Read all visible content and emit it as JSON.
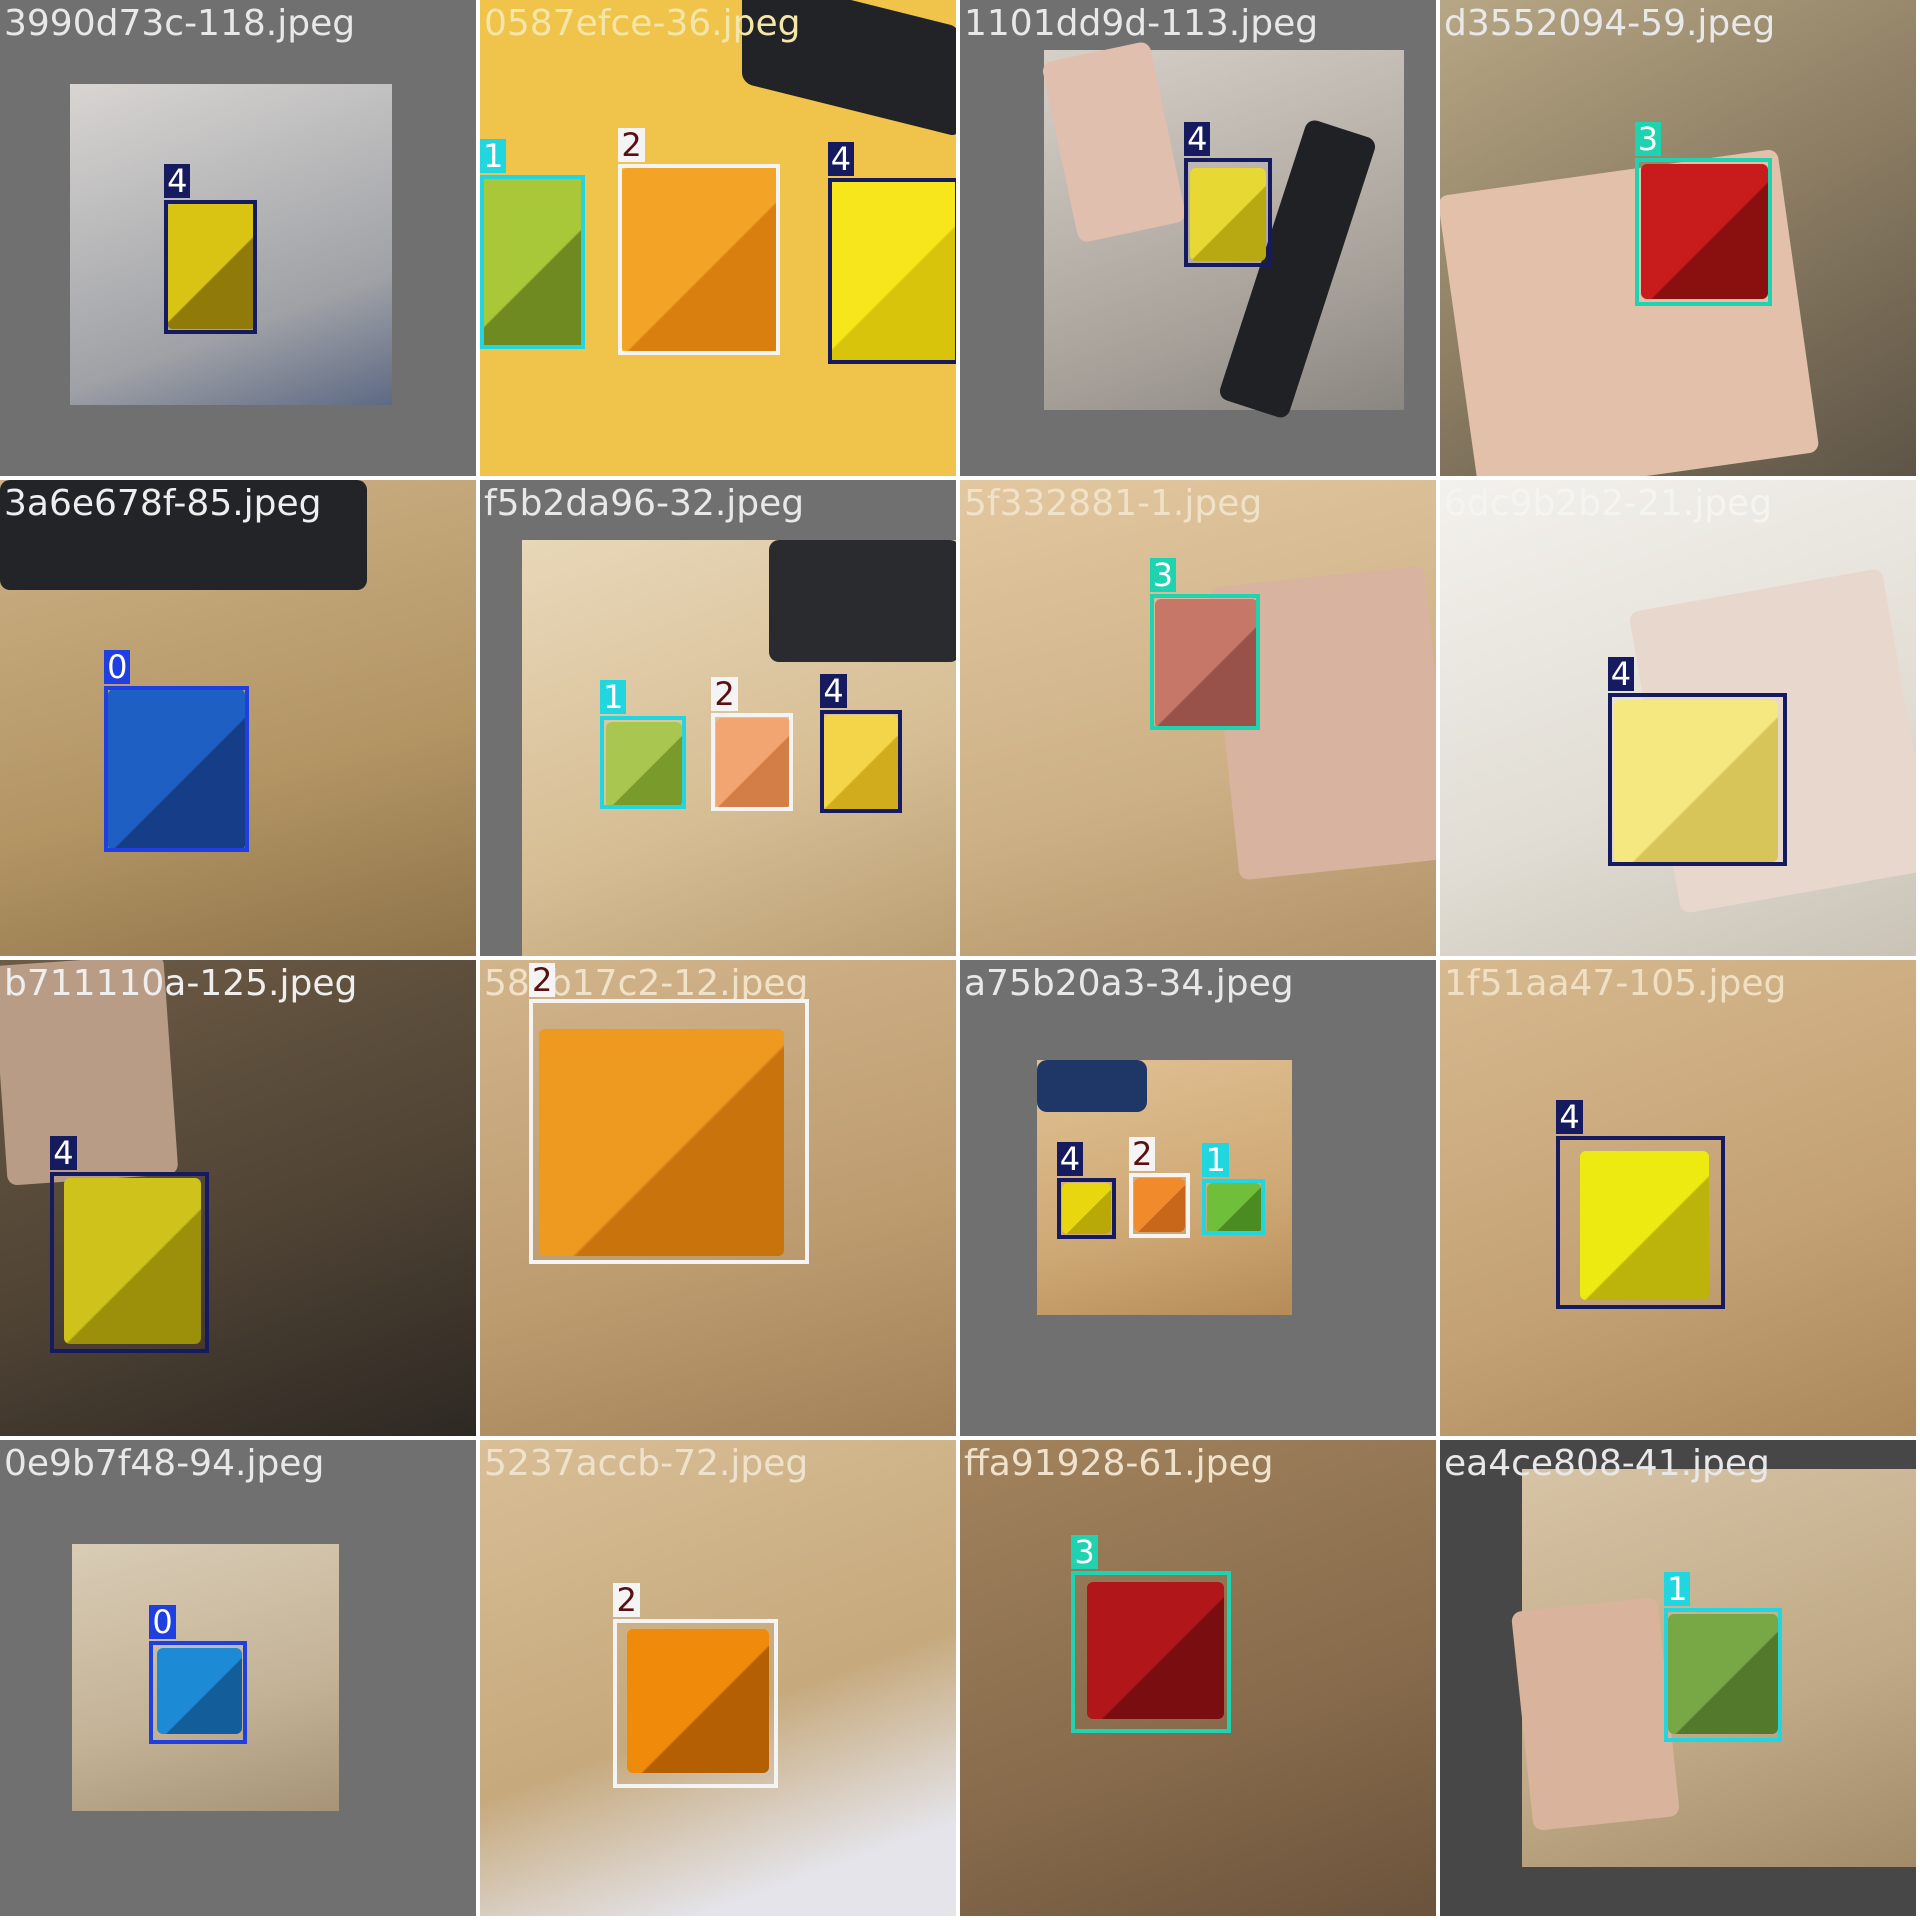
{
  "class_colors": {
    "0": "#1f3fe0",
    "1": "#22d6e0",
    "2": "#f4f4f4",
    "3": "#1fd3b0",
    "4": "#161a5e"
  },
  "tag_text_colors": {
    "0": "#ffffff",
    "1": "#ffffff",
    "2": "#5a1010",
    "3": "#ffffff",
    "4": "#ffffff"
  },
  "tiles": [
    {
      "filename": "3990d73c-118.jpeg",
      "filename_color": "#e8e8e8",
      "detections": [
        {
          "label": "4"
        }
      ]
    },
    {
      "filename": "0587efce-36.jpeg",
      "filename_color": "#f3e6a8",
      "detections": [
        {
          "label": "1"
        },
        {
          "label": "2"
        },
        {
          "label": "4"
        }
      ]
    },
    {
      "filename": "1101dd9d-113.jpeg",
      "filename_color": "#e8e8e8",
      "detections": [
        {
          "label": "4"
        }
      ]
    },
    {
      "filename": "d3552094-59.jpeg",
      "filename_color": "#e8e8e8",
      "detections": [
        {
          "label": "3"
        }
      ]
    },
    {
      "filename": "3a6e678f-85.jpeg",
      "filename_color": "#eeeeee",
      "detections": [
        {
          "label": "0"
        }
      ]
    },
    {
      "filename": "f5b2da96-32.jpeg",
      "filename_color": "#e8e8e8",
      "detections": [
        {
          "label": "1"
        },
        {
          "label": "2"
        },
        {
          "label": "4"
        }
      ]
    },
    {
      "filename": "5f332881-1.jpeg",
      "filename_color": "#f0e2c8",
      "detections": [
        {
          "label": "3"
        }
      ]
    },
    {
      "filename": "6dc9b2b2-21.jpeg",
      "filename_color": "#f4f4f0",
      "detections": [
        {
          "label": "4"
        }
      ]
    },
    {
      "filename": "b711110a-125.jpeg",
      "filename_color": "#eeeeee",
      "detections": [
        {
          "label": "4"
        }
      ]
    },
    {
      "filename": "58?b17c2-12.jpeg",
      "filename_color": "#f0e2c8",
      "detections": [
        {
          "label": "2"
        }
      ]
    },
    {
      "filename": "a75b20a3-34.jpeg",
      "filename_color": "#e8e8e8",
      "detections": [
        {
          "label": "4"
        },
        {
          "label": "2"
        },
        {
          "label": "1"
        }
      ]
    },
    {
      "filename": "1f51aa47-105.jpeg",
      "filename_color": "#efe0c4",
      "detections": [
        {
          "label": "4"
        }
      ]
    },
    {
      "filename": "0e9b7f48-94.jpeg",
      "filename_color": "#e8e8e8",
      "detections": [
        {
          "label": "0"
        }
      ]
    },
    {
      "filename": "5237accb-72.jpeg",
      "filename_color": "#efe2cc",
      "detections": [
        {
          "label": "2"
        }
      ]
    },
    {
      "filename": "ffa91928-61.jpeg",
      "filename_color": "#efe2cc",
      "detections": [
        {
          "label": "3"
        }
      ]
    },
    {
      "filename": "ea4ce808-41.jpeg",
      "filename_color": "#e8e8e8",
      "detections": [
        {
          "label": "1"
        }
      ]
    }
  ]
}
